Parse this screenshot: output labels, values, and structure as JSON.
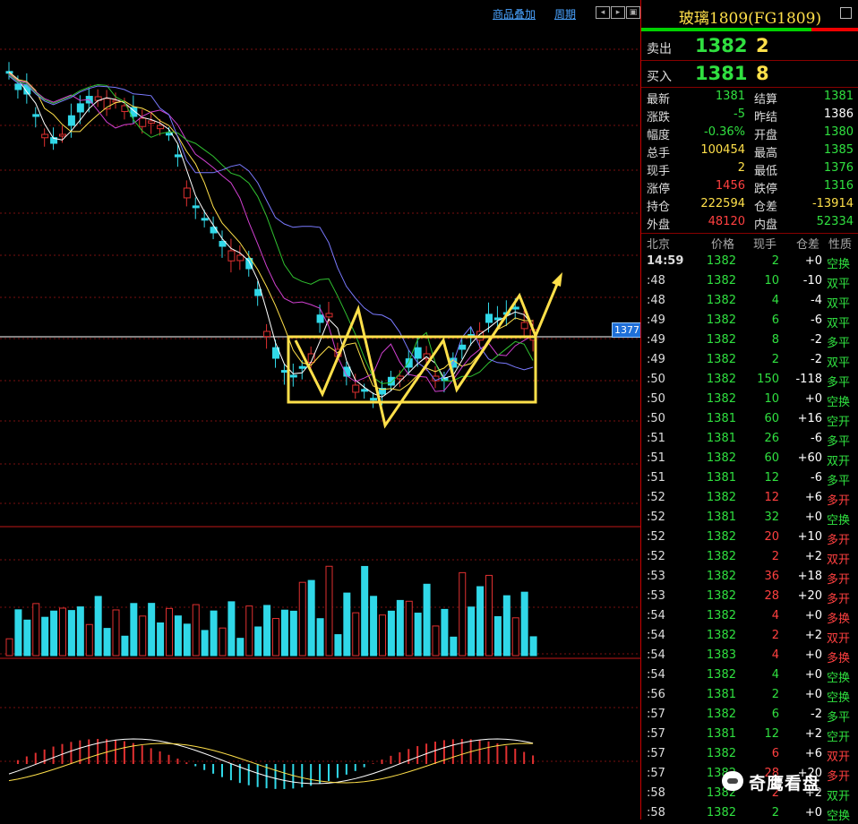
{
  "toolbar": {
    "overlay_link": "商品叠加",
    "period_link": "周期"
  },
  "price_tag": "1377",
  "panel": {
    "title": "玻璃1809(FG1809)",
    "sell": {
      "label": "卖出",
      "price": "1382",
      "qty": "2"
    },
    "buy": {
      "label": "买入",
      "price": "1381",
      "qty": "8"
    },
    "stats": [
      {
        "k1": "最新",
        "v1": "1381",
        "c1": "#30e040",
        "k2": "结算",
        "v2": "1381",
        "c2": "#30e040"
      },
      {
        "k1": "涨跌",
        "v1": "-5",
        "c1": "#30e040",
        "k2": "昨结",
        "v2": "1386",
        "c2": "#ffffff"
      },
      {
        "k1": "幅度",
        "v1": "-0.36%",
        "c1": "#30e040",
        "k2": "开盘",
        "v2": "1380",
        "c2": "#30e040"
      },
      {
        "k1": "总手",
        "v1": "100454",
        "c1": "#ffe04a",
        "k2": "最高",
        "v2": "1385",
        "c2": "#30e040"
      },
      {
        "k1": "现手",
        "v1": "2",
        "c1": "#ffe04a",
        "k2": "最低",
        "v2": "1376",
        "c2": "#30e040"
      },
      {
        "k1": "涨停",
        "v1": "1456",
        "c1": "#ff4040",
        "k2": "跌停",
        "v2": "1316",
        "c2": "#30e040"
      },
      {
        "k1": "持仓",
        "v1": "222594",
        "c1": "#ffe04a",
        "k2": "仓差",
        "v2": "-13914",
        "c2": "#ffe04a"
      },
      {
        "k1": "外盘",
        "v1": "48120",
        "c1": "#ff4040",
        "k2": "内盘",
        "v2": "52334",
        "c2": "#30e040"
      }
    ],
    "headers": {
      "time": "北京",
      "price": "价格",
      "vol": "现手",
      "chg": "仓差",
      "type": "性质"
    },
    "ticks": [
      {
        "time": "14:59",
        "price": "1382",
        "vol": "2",
        "chg": "+0",
        "type": "空换",
        "pc": "#30e040",
        "vc": "#30e040",
        "tc": "#30e040"
      },
      {
        "time": ":48",
        "price": "1382",
        "vol": "10",
        "chg": "-10",
        "type": "双平",
        "pc": "#30e040",
        "vc": "#30e040",
        "tc": "#30e040"
      },
      {
        "time": ":48",
        "price": "1382",
        "vol": "4",
        "chg": "-4",
        "type": "双平",
        "pc": "#30e040",
        "vc": "#30e040",
        "tc": "#30e040"
      },
      {
        "time": ":49",
        "price": "1382",
        "vol": "6",
        "chg": "-6",
        "type": "双平",
        "pc": "#30e040",
        "vc": "#30e040",
        "tc": "#30e040"
      },
      {
        "time": ":49",
        "price": "1382",
        "vol": "8",
        "chg": "-2",
        "type": "多平",
        "pc": "#30e040",
        "vc": "#30e040",
        "tc": "#30e040"
      },
      {
        "time": ":49",
        "price": "1382",
        "vol": "2",
        "chg": "-2",
        "type": "双平",
        "pc": "#30e040",
        "vc": "#30e040",
        "tc": "#30e040"
      },
      {
        "time": ":50",
        "price": "1382",
        "vol": "150",
        "chg": "-118",
        "type": "多平",
        "pc": "#30e040",
        "vc": "#30e040",
        "tc": "#30e040"
      },
      {
        "time": ":50",
        "price": "1382",
        "vol": "10",
        "chg": "+0",
        "type": "空换",
        "pc": "#30e040",
        "vc": "#30e040",
        "tc": "#30e040"
      },
      {
        "time": ":50",
        "price": "1381",
        "vol": "60",
        "chg": "+16",
        "type": "空开",
        "pc": "#30e040",
        "vc": "#30e040",
        "tc": "#30e040"
      },
      {
        "time": ":51",
        "price": "1381",
        "vol": "26",
        "chg": "-6",
        "type": "多平",
        "pc": "#30e040",
        "vc": "#30e040",
        "tc": "#30e040"
      },
      {
        "time": ":51",
        "price": "1382",
        "vol": "60",
        "chg": "+60",
        "type": "双开",
        "pc": "#30e040",
        "vc": "#30e040",
        "tc": "#30e040"
      },
      {
        "time": ":51",
        "price": "1381",
        "vol": "12",
        "chg": "-6",
        "type": "多平",
        "pc": "#30e040",
        "vc": "#30e040",
        "tc": "#30e040"
      },
      {
        "time": ":52",
        "price": "1382",
        "vol": "12",
        "chg": "+6",
        "type": "多开",
        "pc": "#30e040",
        "vc": "#ff4040",
        "tc": "#ff4040"
      },
      {
        "time": ":52",
        "price": "1381",
        "vol": "32",
        "chg": "+0",
        "type": "空换",
        "pc": "#30e040",
        "vc": "#30e040",
        "tc": "#30e040"
      },
      {
        "time": ":52",
        "price": "1382",
        "vol": "20",
        "chg": "+10",
        "type": "多开",
        "pc": "#30e040",
        "vc": "#ff4040",
        "tc": "#ff4040"
      },
      {
        "time": ":52",
        "price": "1382",
        "vol": "2",
        "chg": "+2",
        "type": "双开",
        "pc": "#30e040",
        "vc": "#ff4040",
        "tc": "#ff4040"
      },
      {
        "time": ":53",
        "price": "1382",
        "vol": "36",
        "chg": "+18",
        "type": "多开",
        "pc": "#30e040",
        "vc": "#ff4040",
        "tc": "#ff4040"
      },
      {
        "time": ":53",
        "price": "1382",
        "vol": "28",
        "chg": "+20",
        "type": "多开",
        "pc": "#30e040",
        "vc": "#ff4040",
        "tc": "#ff4040"
      },
      {
        "time": ":54",
        "price": "1382",
        "vol": "4",
        "chg": "+0",
        "type": "多换",
        "pc": "#30e040",
        "vc": "#ff4040",
        "tc": "#ff4040"
      },
      {
        "time": ":54",
        "price": "1382",
        "vol": "2",
        "chg": "+2",
        "type": "双开",
        "pc": "#30e040",
        "vc": "#ff4040",
        "tc": "#ff4040"
      },
      {
        "time": ":54",
        "price": "1383",
        "vol": "4",
        "chg": "+0",
        "type": "多换",
        "pc": "#30e040",
        "vc": "#ff4040",
        "tc": "#ff4040"
      },
      {
        "time": ":54",
        "price": "1382",
        "vol": "4",
        "chg": "+0",
        "type": "空换",
        "pc": "#30e040",
        "vc": "#30e040",
        "tc": "#30e040"
      },
      {
        "time": ":56",
        "price": "1381",
        "vol": "2",
        "chg": "+0",
        "type": "空换",
        "pc": "#30e040",
        "vc": "#30e040",
        "tc": "#30e040"
      },
      {
        "time": ":57",
        "price": "1382",
        "vol": "6",
        "chg": "-2",
        "type": "多平",
        "pc": "#30e040",
        "vc": "#30e040",
        "tc": "#30e040"
      },
      {
        "time": ":57",
        "price": "1381",
        "vol": "12",
        "chg": "+2",
        "type": "空开",
        "pc": "#30e040",
        "vc": "#30e040",
        "tc": "#30e040"
      },
      {
        "time": ":57",
        "price": "1382",
        "vol": "6",
        "chg": "+6",
        "type": "双开",
        "pc": "#30e040",
        "vc": "#ff4040",
        "tc": "#ff4040"
      },
      {
        "time": ":57",
        "price": "1382",
        "vol": "28",
        "chg": "+20",
        "type": "多开",
        "pc": "#30e040",
        "vc": "#ff4040",
        "tc": "#ff4040"
      },
      {
        "time": ":58",
        "price": "1382",
        "vol": "2",
        "chg": "+2",
        "type": "双开",
        "pc": "#30e040",
        "vc": "#ff4040",
        "tc": "#30e040"
      },
      {
        "time": ":58",
        "price": "1382",
        "vol": "2",
        "chg": "+0",
        "type": "空换",
        "pc": "#30e040",
        "vc": "#30e040",
        "tc": "#30e040"
      }
    ]
  },
  "watermark": "奇鹰看盘"
}
